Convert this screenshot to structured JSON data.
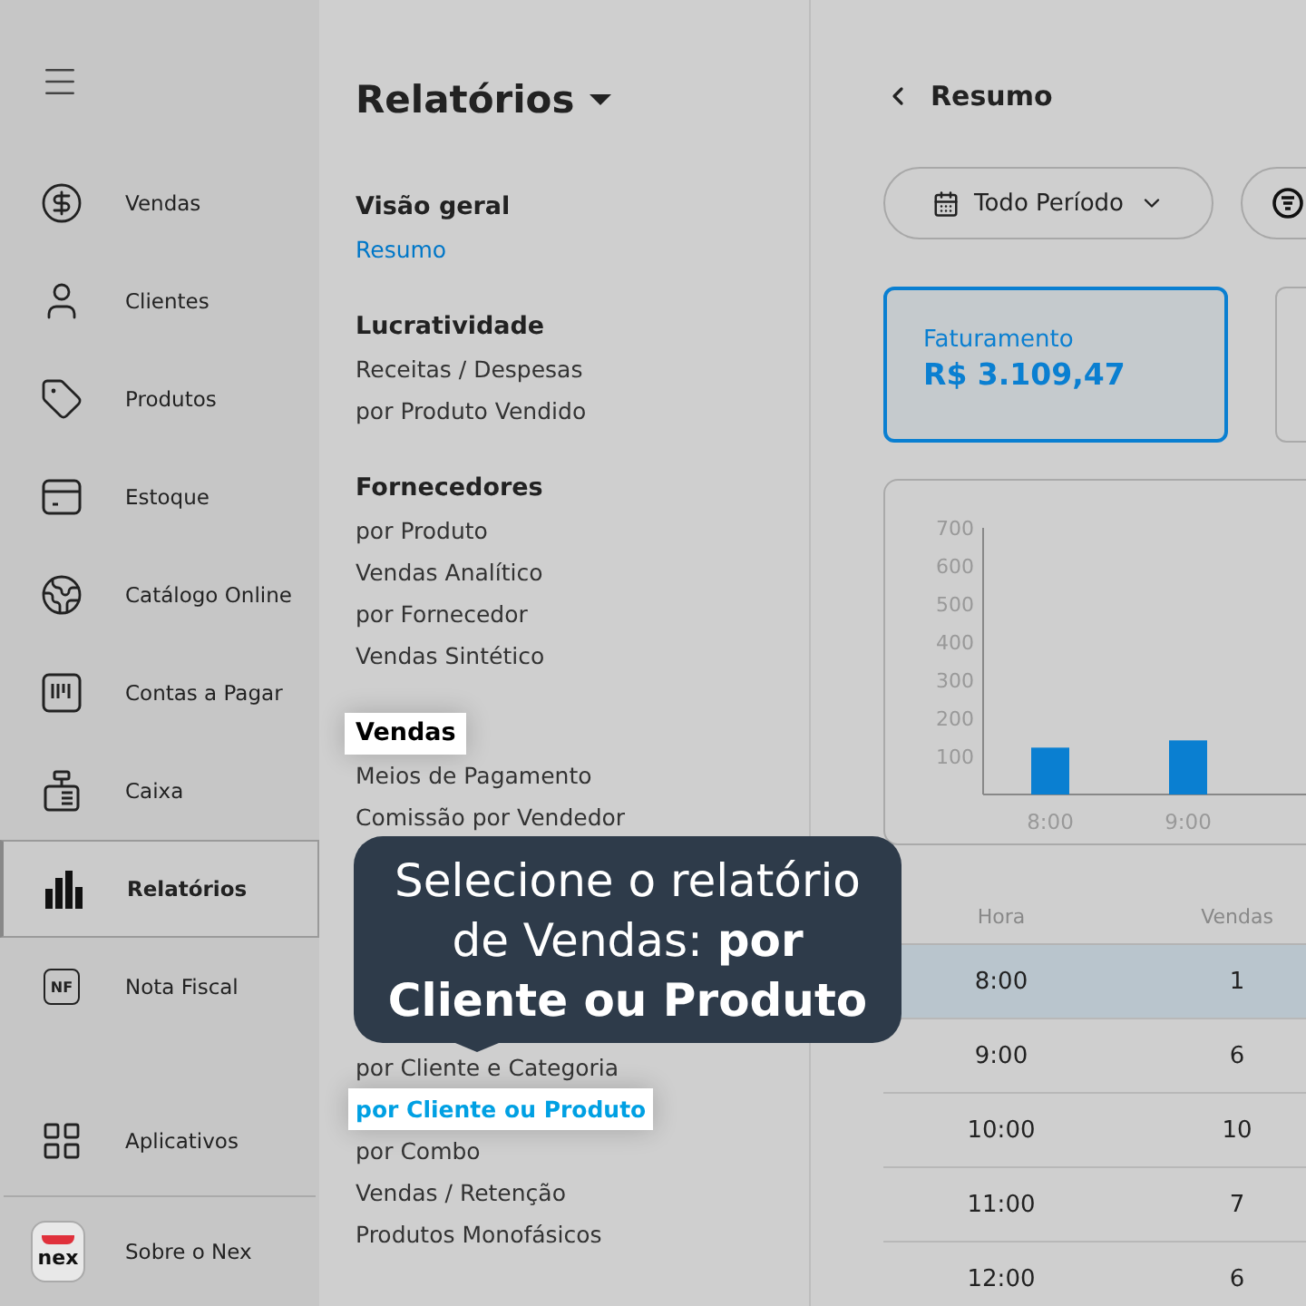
{
  "sidebar": {
    "items": [
      {
        "label": "Vendas",
        "selected": false
      },
      {
        "label": "Clientes",
        "selected": false
      },
      {
        "label": "Produtos",
        "selected": false
      },
      {
        "label": "Estoque",
        "selected": false
      },
      {
        "label": "Catálogo Online",
        "selected": false
      },
      {
        "label": "Contas a Pagar",
        "selected": false
      },
      {
        "label": "Caixa",
        "selected": false
      },
      {
        "label": "Relatórios",
        "selected": true
      },
      {
        "label": "Nota Fiscal",
        "selected": false,
        "badge": "NF"
      }
    ],
    "bottom": [
      {
        "label": "Aplicativos"
      },
      {
        "label": "Sobre o Nex",
        "logo": "nex"
      }
    ]
  },
  "reports": {
    "title": "Relatórios",
    "sections": [
      {
        "heading": "Visão geral",
        "highlighted": false,
        "items": [
          {
            "label": "Resumo",
            "selected": true,
            "highlighted": false
          }
        ]
      },
      {
        "heading": "Lucratividade",
        "highlighted": false,
        "items": [
          {
            "label": "Receitas / Despesas",
            "selected": false,
            "highlighted": false
          },
          {
            "label": "por Produto Vendido",
            "selected": false,
            "highlighted": false
          }
        ]
      },
      {
        "heading": "Fornecedores",
        "highlighted": false,
        "items": [
          {
            "label": "por Produto",
            "selected": false,
            "highlighted": false
          },
          {
            "label": "Vendas Analítico",
            "selected": false,
            "highlighted": false
          },
          {
            "label": "por Fornecedor",
            "selected": false,
            "highlighted": false
          },
          {
            "label": "Vendas Sintético",
            "selected": false,
            "highlighted": false
          }
        ]
      },
      {
        "heading": "Vendas",
        "highlighted": true,
        "items": [
          {
            "label": "Meios de Pagamento",
            "selected": false,
            "highlighted": false
          },
          {
            "label": "Comissão por Vendedor",
            "selected": false,
            "highlighted": false
          },
          {
            "label": "por Cliente e Categoria",
            "selected": false,
            "highlighted": false
          },
          {
            "label": "por Cliente ou Produto",
            "selected": true,
            "highlighted": true
          },
          {
            "label": "por Combo",
            "selected": false,
            "highlighted": false
          },
          {
            "label": "Vendas / Retenção",
            "selected": false,
            "highlighted": false
          },
          {
            "label": "Produtos Monofásicos",
            "selected": false,
            "highlighted": false
          }
        ]
      }
    ]
  },
  "tooltip": {
    "text": "Selecione o relatório de Vendas: **por Cliente ou Produto**"
  },
  "summary": {
    "back_title": "Resumo",
    "period_button": "Todo Período",
    "cards": [
      {
        "label": "Faturamento",
        "value": "R$ 3.109,47",
        "selected": true
      },
      {
        "selected": false
      }
    ],
    "chart_data": {
      "type": "bar",
      "categories": [
        "8:00",
        "9:00"
      ],
      "values": [
        123,
        142
      ],
      "ylim": [
        0,
        700
      ],
      "yticks": [
        100,
        200,
        300,
        400,
        500,
        600,
        700
      ]
    },
    "table": {
      "columns": [
        "Hora",
        "Vendas"
      ],
      "rows": [
        {
          "cells": [
            "8:00",
            "1"
          ],
          "selected": true
        },
        {
          "cells": [
            "9:00",
            "6"
          ],
          "selected": false
        },
        {
          "cells": [
            "10:00",
            "10"
          ],
          "selected": false
        },
        {
          "cells": [
            "11:00",
            "7"
          ],
          "selected": false
        },
        {
          "cells": [
            "12:00",
            "6"
          ],
          "selected": false
        }
      ]
    }
  }
}
